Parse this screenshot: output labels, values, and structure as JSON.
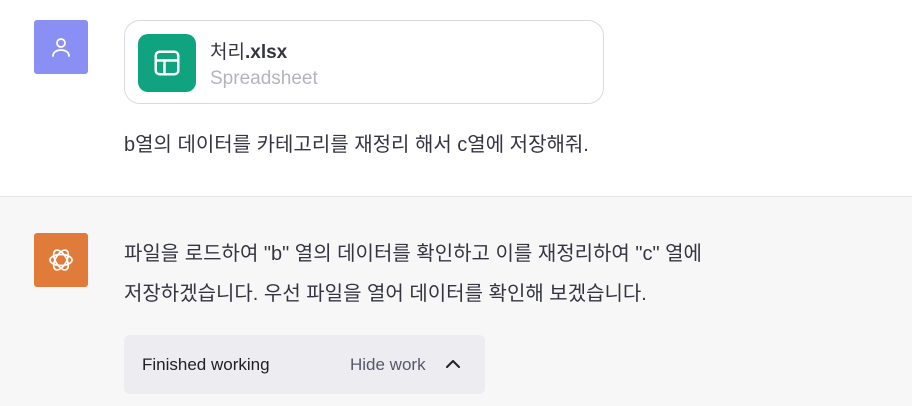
{
  "user_message": {
    "attachment": {
      "file_name_base": "처리",
      "file_name_ext": ".xlsx",
      "file_type": "Spreadsheet",
      "icon": "spreadsheet-icon"
    },
    "text": "b열의 데이터를 카테고리를 재정리 해서 c열에 저장해줘."
  },
  "assistant_message": {
    "line1": "파일을 로드하여 \"b\" 열의 데이터를 확인하고 이를 재정리하여 \"c\" 열에",
    "line2": "저장하겠습니다. 우선 파일을 열어 데이터를 확인해 보겠습니다."
  },
  "work_panel": {
    "status": "Finished working",
    "toggle_label": "Hide work",
    "toggle_icon": "chevron-up-icon"
  },
  "colors": {
    "user_avatar": "#8a8ff3",
    "assistant_avatar": "#e07b39",
    "spreadsheet_icon": "#10a37f"
  }
}
